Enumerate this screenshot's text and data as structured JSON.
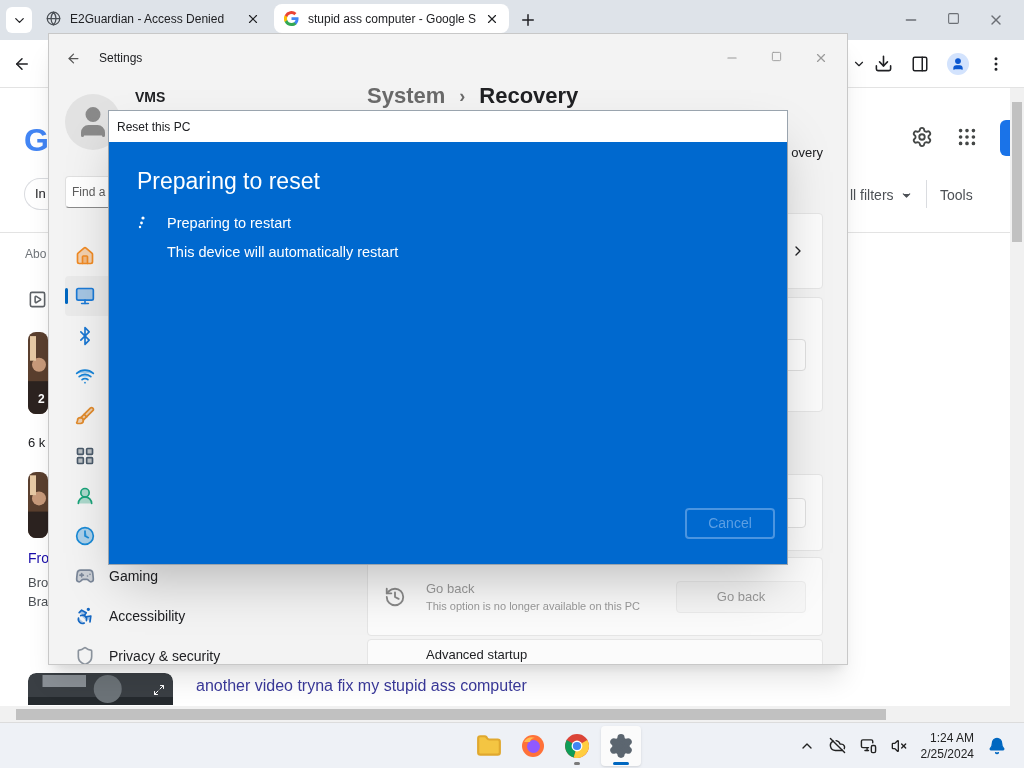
{
  "browser": {
    "tabs": [
      {
        "title": "E2Guardian - Access Denied",
        "kind": "globe",
        "selected": false
      },
      {
        "title": "stupid ass computer - Google S",
        "kind": "google",
        "selected": true
      }
    ]
  },
  "google_page": {
    "logo": "G",
    "chip": "In",
    "about": "Abo",
    "duration": "2",
    "views": "6 k",
    "link": "Fro",
    "snippet_1": "Bro",
    "snippet_2": "Bra",
    "filters": "ll filters",
    "tools": "Tools",
    "video_title": "another video tryna fix my stupid ass computer"
  },
  "settings": {
    "title": "Settings",
    "user": "VMS",
    "search_placeholder": "Find a",
    "breadcrumb": {
      "parent": "System",
      "separator": "›",
      "current": "Recovery"
    },
    "description": "overy",
    "sidebar": [
      {
        "kind": "home",
        "selected": false
      },
      {
        "kind": "system",
        "selected": true
      },
      {
        "kind": "bluetooth",
        "selected": false
      },
      {
        "kind": "network",
        "selected": false
      },
      {
        "kind": "personalization",
        "selected": false
      },
      {
        "kind": "apps",
        "selected": false
      },
      {
        "kind": "accounts",
        "selected": false
      },
      {
        "kind": "time",
        "selected": false
      },
      {
        "kind": "gaming",
        "label": "Gaming",
        "selected": false
      },
      {
        "kind": "accessibility",
        "label": "Accessibility",
        "selected": false
      },
      {
        "kind": "privacy",
        "label": "Privacy & security",
        "selected": false
      }
    ],
    "go_back": {
      "title": "Go back",
      "description": "This option is no longer available on this PC",
      "button": "Go back",
      "disabled": true
    },
    "advanced": "Advanced startup"
  },
  "dialog": {
    "title": "Reset this PC",
    "heading": "Preparing to reset",
    "status": "Preparing to restart",
    "detail": "This device will automatically restart",
    "cancel": {
      "label": "Cancel",
      "disabled": true
    }
  },
  "taskbar": {
    "apps": [
      {
        "kind": "folder",
        "running": false,
        "active": false
      },
      {
        "kind": "firefox",
        "running": false,
        "active": false
      },
      {
        "kind": "chrome",
        "running": true,
        "active": false
      },
      {
        "kind": "settings",
        "running": true,
        "active": true
      }
    ],
    "time": "1:24 AM",
    "date": "2/25/2024"
  }
}
